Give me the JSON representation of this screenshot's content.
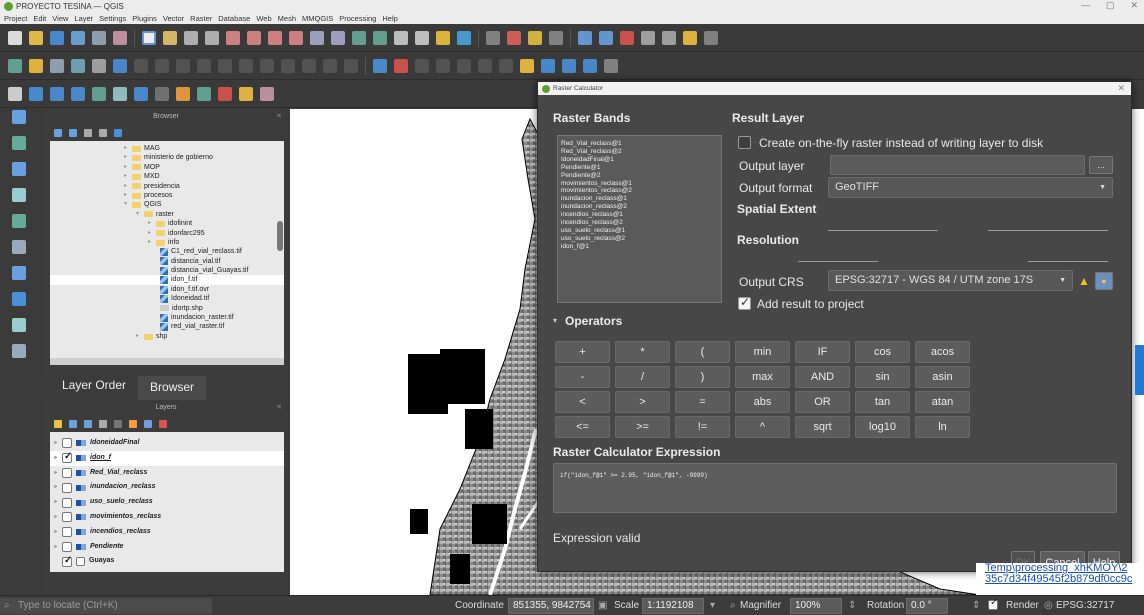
{
  "window": {
    "title": "PROYECTO TESINA — QGIS"
  },
  "menu": [
    "Project",
    "Edit",
    "View",
    "Layer",
    "Settings",
    "Plugins",
    "Vector",
    "Raster",
    "Database",
    "Web",
    "Mesh",
    "MMQGIS",
    "Processing",
    "Help"
  ],
  "browser": {
    "title": "Browser",
    "items": [
      "MAG",
      "ministerio de gobierno",
      "MOP",
      "MXD",
      "presidencia",
      "procesos",
      "QGIS",
      "raster",
      "idofinint",
      "idonfarc295",
      "info",
      "C1_red_vial_reclass.tif",
      "distancia_vial.tif",
      "distancia_vial_Guayas.tif",
      "idon_f.tif",
      "idon_f.tif.ovr",
      "Idoneidad.tif",
      "idortp.shp",
      "inundacion_raster.tif",
      "red_vial_raster.tif",
      "shp"
    ]
  },
  "tabs": {
    "layer_order": "Layer Order",
    "browser": "Browser"
  },
  "layers": {
    "title": "Layers",
    "items": [
      "IdoneidadFinal",
      "idon_f",
      "Red_Vial_reclass",
      "inundacion_reclass",
      "uso_suelo_reclass",
      "movimientos_reclass",
      "incendios_reclass",
      "Pendiente",
      "Guayas"
    ]
  },
  "dialog": {
    "title": "Raster Calculator",
    "raster_bands_label": "Raster Bands",
    "bands": [
      "Red_Vial_reclass@1",
      "Red_Vial_reclass@2",
      "IdoneidadFinal@1",
      "Pendiente@1",
      "Pendiente@2",
      "movimientos_reclass@1",
      "movimientos_reclass@2",
      "inundacion_reclass@1",
      "inundacion_reclass@2",
      "incendios_reclass@1",
      "incendios_reclass@2",
      "uso_suelo_reclass@1",
      "uso_suelo_reclass@2",
      "idon_f@1"
    ],
    "result_layer_label": "Result Layer",
    "onfly_label": "Create on-the-fly raster instead of writing layer to disk",
    "output_layer_label": "Output layer",
    "output_layer_value": "",
    "browse_label": "...",
    "output_format_label": "Output format",
    "output_format_value": "GeoTIFF",
    "spatial_extent_label": "Spatial Extent",
    "resolution_label": "Resolution",
    "output_crs_label": "Output CRS",
    "output_crs_value": "EPSG:32717 - WGS 84 / UTM zone 17S",
    "add_result_label": "Add result to project",
    "operators_label": "Operators",
    "operators": [
      [
        "+",
        "*",
        "(",
        "min",
        "IF",
        "cos",
        "acos"
      ],
      [
        "-",
        "/",
        ")",
        "max",
        "AND",
        "sin",
        "asin"
      ],
      [
        "<",
        ">",
        "=",
        "abs",
        "OR",
        "tan",
        "atan"
      ],
      [
        "<=",
        ">=",
        "!=",
        "^",
        "sqrt",
        "log10",
        "ln"
      ]
    ],
    "expression_label": "Raster Calculator Expression",
    "expression": "if(\"idon_f@1\" >= 2.95, \"idon_f@1\", -9999)",
    "expression_status": "Expression valid",
    "ok_label": "OK",
    "cancel_label": "Cancel",
    "help_label": "Help"
  },
  "log_panel": {
    "line1": "Temp\\processing_xhKMOY\\2",
    "line2": "35c7d34f49545f2b879df0cc9c"
  },
  "status": {
    "locate_placeholder": "Type to locate (Ctrl+K)",
    "coordinate_label": "Coordinate",
    "coordinate_value": "851355, 9842754",
    "scale_label": "Scale",
    "scale_value": "1:1192108",
    "magnifier_label": "Magnifier",
    "magnifier_value": "100%",
    "rotation_label": "Rotation",
    "rotation_value": "0.0 °",
    "render_label": "Render",
    "crs_value": "EPSG:32717"
  },
  "colors": {
    "qgis_green": "#5e9f31",
    "dialog_bg": "#474747",
    "link": "#1a4fb5"
  }
}
